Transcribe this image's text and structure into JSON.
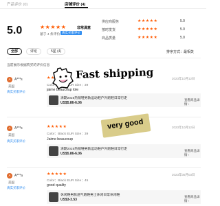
{
  "tabs": [
    {
      "label": "产品评价 (0)"
    },
    {
      "label": "店铺评价 (4)"
    }
  ],
  "summary": {
    "score": "5.0",
    "stars": "★★★★★",
    "rating_word": "非常满意",
    "count_text": "基于 4 条评价",
    "badge": "真实买家评价"
  },
  "metrics": [
    {
      "label": "供应商服务",
      "value": "5.0"
    },
    {
      "label": "按时发货",
      "value": "5.0"
    },
    {
      "label": "商品质量",
      "value": "5.0"
    }
  ],
  "filters": [
    {
      "label": "全部"
    },
    {
      "label": "评论"
    },
    {
      "label": "5星 (4)"
    }
  ],
  "sort": {
    "label": "排序方式：最相关"
  },
  "notice": "当前展示根据购买的评价信息",
  "reviews": [
    {
      "initial": "A",
      "name": "A***s",
      "country": "美国",
      "tag": "真实买家评价",
      "date": "2023年10月12日",
      "stars": "★★★★★",
      "meta": "Color：Black    EUR Size：39",
      "text": "jaime beaucoup lole",
      "product": {
        "title": "清期2025热销鞋男款运动鞋户外跑鞋日常行走",
        "price": "US$5.86-6.06",
        "link": "查看商品详情 ›"
      }
    },
    {
      "initial": "A",
      "name": "A***s",
      "country": "美国",
      "tag": "真实买家评价",
      "date": "2023年10月12日",
      "stars": "★★★★★",
      "meta": "Color：Black    EUR Size：39",
      "text": "Jaime beaucoup",
      "product": {
        "title": "清期2025热销鞋男款运动鞋户外跑鞋日常行走",
        "price": "US$5.86-6.06",
        "link": "查看商品详情 ›"
      }
    },
    {
      "initial": "A",
      "name": "A***a",
      "country": "美国",
      "tag": "真实买家评价",
      "date": "2023年05月03日",
      "stars": "★★★★★",
      "meta": "Color：Black    EUR Size：45",
      "text": "good quality",
      "product": {
        "title": "休闲鞋男款透气跑鞋男士休闲日常休闲鞋",
        "price": "US$3-3.53",
        "link": "查看商品详情 ›"
      }
    }
  ],
  "stickers": {
    "fast_shipping": "Fast shipping",
    "very_good": "very good"
  },
  "colors": {
    "accent_orange": "#ff5a00",
    "badge_blue": "#2e8cf0"
  }
}
